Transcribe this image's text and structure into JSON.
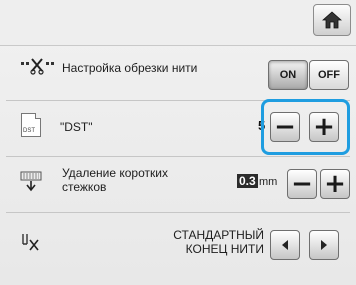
{
  "home": {
    "icon": "home-icon"
  },
  "thread_trim": {
    "icon": "thread-trim-icon",
    "label": "Настройка обрезки нити",
    "on_label": "ON",
    "off_label": "OFF",
    "active": "ON"
  },
  "dst": {
    "icon": "dst-file-icon",
    "icon_text": "DST",
    "label": "\"DST\"",
    "value": "5",
    "minus_label": "−",
    "plus_label": "+"
  },
  "short_stitch": {
    "icon": "short-stitch-icon",
    "label_line1": "Удаление коротких",
    "label_line2": "стежков",
    "value": "0.3",
    "unit": "mm",
    "minus_label": "−",
    "plus_label": "+"
  },
  "thread_end": {
    "icon": "thread-end-icon",
    "label_line1": "СТАНДАРТНЫЙ",
    "label_line2": "КОНЕЦ НИТИ",
    "left_icon": "arrow-left-icon",
    "right_icon": "arrow-right-icon"
  },
  "colors": {
    "focus": "#1f9de0",
    "background": "#eeeeee"
  }
}
